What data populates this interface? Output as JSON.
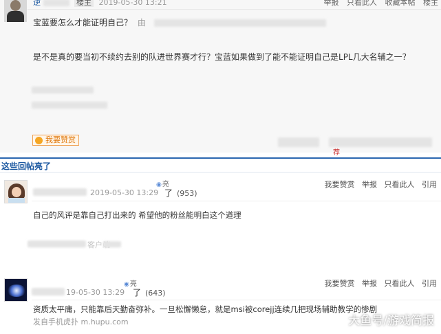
{
  "op": {
    "username": "逆",
    "role_tag": "楼主",
    "timestamp": "2019-05-30 13:21",
    "actions": [
      "举报",
      "只看此人",
      "收藏本帖",
      "楼主"
    ],
    "quote_title": "宝蓝要怎么才能证明自己？",
    "quote_from": "由",
    "body": "是不是真的要当初不续约去别的队进世界赛才行？宝蓝如果做到了能不能证明自己是LPL几大名辅之一？",
    "reward_label": "我要赞赏",
    "recommend_label": "荐"
  },
  "section_title": "这些回帖亮了",
  "replies": [
    {
      "timestamp": "2019-05-30 13:29",
      "light_label": "亮",
      "liang_label": "了",
      "light_count": "(953)",
      "actions": [
        "我要赞赏",
        "举报",
        "只看此人",
        "引用"
      ],
      "body": "自己的风评是靠自己打出来的 希望他的粉丝能明白这个道理",
      "client_text": "客户端"
    },
    {
      "timestamp": "19-05-30 13:29",
      "light_label": "亮",
      "liang_label": "了",
      "light_count": "(643)",
      "actions": [
        "我要赞赏",
        "举报",
        "只看此人",
        "引用"
      ],
      "body": "资质太平庸，只能靠后天勤奋弥补。一旦松懈懒怠，就是msi被corejj连续几把现场辅助教学的惨剧",
      "source": "发自手机虎扑 m.hupu.com"
    }
  ],
  "watermark": "大鱼号/游戏简报",
  "colors": {
    "link_blue": "#1a57a0",
    "section_border": "#2a66b0",
    "reward_orange": "#e07a10",
    "meta_gray": "#999999"
  }
}
